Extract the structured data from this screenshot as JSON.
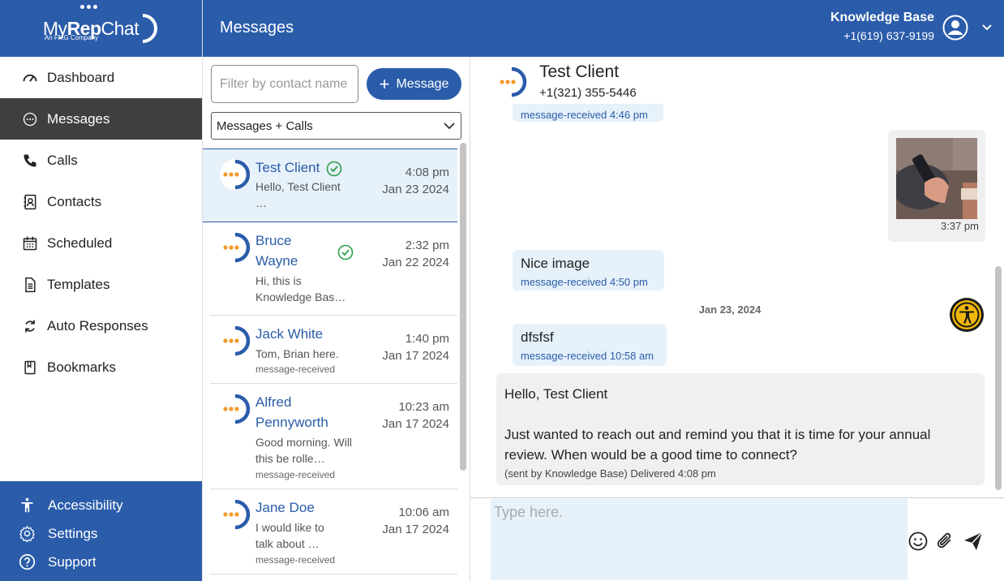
{
  "sidebar": {
    "brand": {
      "name_a": "My",
      "name_b": "Rep",
      "name_c": "Chat",
      "tagline": "An FMG Company"
    },
    "items": [
      {
        "label": "Dashboard",
        "icon": "speedometer-icon"
      },
      {
        "label": "Messages",
        "icon": "chat-bubble-icon",
        "active": true
      },
      {
        "label": "Calls",
        "icon": "phone-icon"
      },
      {
        "label": "Contacts",
        "icon": "contacts-icon"
      },
      {
        "label": "Scheduled",
        "icon": "calendar-icon"
      },
      {
        "label": "Templates",
        "icon": "document-icon"
      },
      {
        "label": "Auto Responses",
        "icon": "refresh-icon"
      },
      {
        "label": "Bookmarks",
        "icon": "bookmark-icon"
      }
    ],
    "bottom": [
      {
        "label": "Accessibility",
        "icon": "accessibility-icon"
      },
      {
        "label": "Settings",
        "icon": "gear-icon"
      },
      {
        "label": "Support",
        "icon": "help-icon"
      }
    ]
  },
  "header": {
    "title": "Messages",
    "account_name": "Knowledge Base",
    "account_phone": "+1(619) 637-9199"
  },
  "list": {
    "filter_placeholder": "Filter by contact name",
    "new_message_label": "Message",
    "view_select": "Messages + Calls",
    "conversations": [
      {
        "name": "Test Client",
        "preview": "Hello, Test Client …",
        "time": "4:08 pm",
        "date": "Jan 23 2024",
        "verified": true,
        "selected": true
      },
      {
        "name": "Bruce Wayne",
        "preview": "Hi, this is Knowledge Bas…",
        "time": "2:32 pm",
        "date": "Jan 22 2024",
        "verified": true
      },
      {
        "name": "Jack White",
        "preview": "Tom, Brian here.",
        "status": "message-received",
        "time": "1:40 pm",
        "date": "Jan 17 2024"
      },
      {
        "name": "Alfred Pennyworth",
        "preview": "Good morning. Will this be rolle…",
        "status": "message-received",
        "time": "10:23 am",
        "date": "Jan 17 2024"
      },
      {
        "name": "Jane Doe",
        "preview": "I would like to talk about …",
        "status": "message-received",
        "time": "10:06 am",
        "date": "Jan 17 2024"
      }
    ]
  },
  "chat": {
    "contact_name": "Test Client",
    "contact_phone": "+1(321) 355-5446",
    "partial_status": "message-received 4:46 pm",
    "image_time": "3:37 pm",
    "messages_in": [
      {
        "text": "Nice image",
        "status": "message-received 4:50 pm"
      },
      {
        "text": "dfsfsf",
        "status": "message-received 10:58 am"
      }
    ],
    "date_separator": "Jan 23, 2024",
    "outgoing": {
      "text": "Hello, Test Client\n\nJust wanted to reach out and remind you that it is time for your annual review. When would be a good time to connect?",
      "status": "(sent by Knowledge Base) Delivered 4:08 pm"
    },
    "composer_placeholder": "Type here."
  },
  "colors": {
    "brand": "#2a5caa",
    "active_nav": "#3f3f3f",
    "incoming_bubble": "#e6f1fa",
    "outgoing_bubble": "#f0f0f0",
    "avatar_dots": "#f39a2b",
    "verified": "#2e9e4a"
  }
}
